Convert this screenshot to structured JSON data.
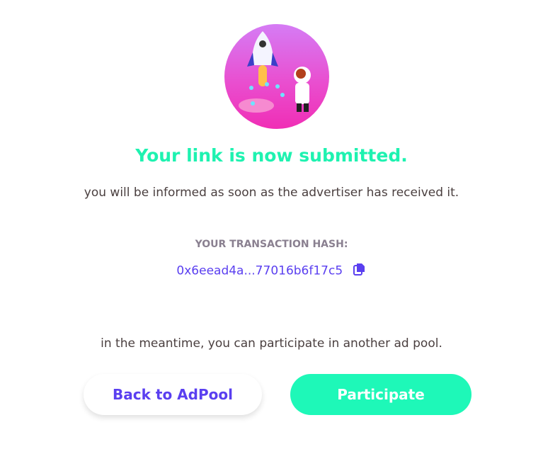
{
  "title": "Your link is now submitted.",
  "subtitle": "you will be informed as soon as the advertiser has received it.",
  "hash_label": "YOUR TRANSACTION HASH:",
  "hash_value": "0x6eead4a...77016b6f17c5",
  "meantime": "in the meantime, you can participate in another ad pool.",
  "buttons": {
    "back": "Back to AdPool",
    "participate": "Participate"
  },
  "colors": {
    "accent": "#1ef2b0",
    "link": "#5a3ff0"
  }
}
